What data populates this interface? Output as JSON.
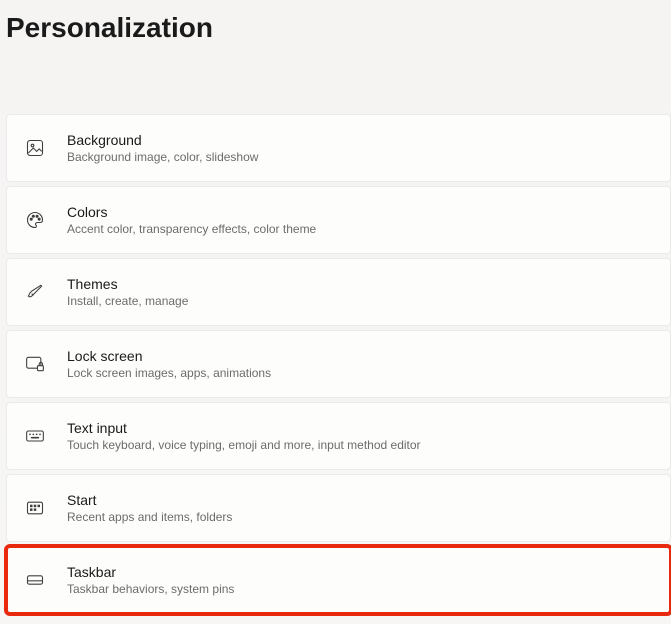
{
  "page": {
    "title": "Personalization"
  },
  "settings": {
    "items": [
      {
        "id": "background",
        "title": "Background",
        "subtitle": "Background image, color, slideshow"
      },
      {
        "id": "colors",
        "title": "Colors",
        "subtitle": "Accent color, transparency effects, color theme"
      },
      {
        "id": "themes",
        "title": "Themes",
        "subtitle": "Install, create, manage"
      },
      {
        "id": "lockscreen",
        "title": "Lock screen",
        "subtitle": "Lock screen images, apps, animations"
      },
      {
        "id": "textinput",
        "title": "Text input",
        "subtitle": "Touch keyboard, voice typing, emoji and more, input method editor"
      },
      {
        "id": "start",
        "title": "Start",
        "subtitle": "Recent apps and items, folders"
      },
      {
        "id": "taskbar",
        "title": "Taskbar",
        "subtitle": "Taskbar behaviors, system pins"
      }
    ]
  }
}
